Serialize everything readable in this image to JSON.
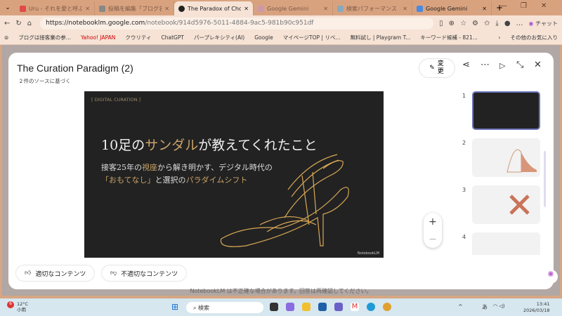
{
  "browser": {
    "tabs": [
      {
        "label": "Uru - それを愛と呼ぶなら",
        "active": false
      },
      {
        "label": "投稿を編集「ブログ名の",
        "active": false
      },
      {
        "label": "The Paradox of Choice in",
        "active": true
      },
      {
        "label": "Google Gemini",
        "active": false
      },
      {
        "label": "検索パフォーマンス",
        "active": false
      },
      {
        "label": "Google Gemini",
        "active": false
      }
    ],
    "url_host": "https://notebooklm.google.com",
    "url_path": "/notebook/914d5976-5011-4884-9ac5-981b90c951df",
    "chat_label": "チャット",
    "bookmarks": [
      "ブログは接客業の参...",
      "Yahoo! JAPAN",
      "クウリティ",
      "ChatGPT",
      "パープレキシティ(AI)",
      "Google",
      "マイページTOP | リベ...",
      "無料試し | Playgram T...",
      "キーワード候補 - 821..."
    ],
    "other_bookmarks": "その他のお気に入り"
  },
  "modal": {
    "title": "The Curation Paradigm (2)",
    "subtitle": "２件のソースに基づく",
    "edit_label": "変更",
    "slide": {
      "tag": "[ DIGITAL CURATION ]",
      "title_pre": "10足の",
      "title_hl": "サンダル",
      "title_post": "が教えてくれたこと",
      "line1_pre": "接客25年の",
      "line1_hl": "視座",
      "line1_post": "から解き明かす、デジタル時代の",
      "line2_hl": "「おもてなし」",
      "line2_mid": "と選択の",
      "line2_hl2": "パラダイムシフト",
      "watermark": "NotebookLM",
      "accent": "#c9a36a"
    },
    "thumbnails": [
      {
        "num": "1",
        "selected": true
      },
      {
        "num": "2"
      },
      {
        "num": "3"
      },
      {
        "num": "4"
      }
    ],
    "feedback": {
      "good": "適切なコンテンツ",
      "bad": "不適切なコンテンツ"
    }
  },
  "disclaimer": "NotebookLM は不正確な場合があります。回答は再確認してください。",
  "taskbar": {
    "temp": "12°C",
    "weather": "小雨",
    "badge": "6",
    "search": "検索",
    "ime": "あ",
    "time": "13:41",
    "date": "2026/03/18"
  }
}
